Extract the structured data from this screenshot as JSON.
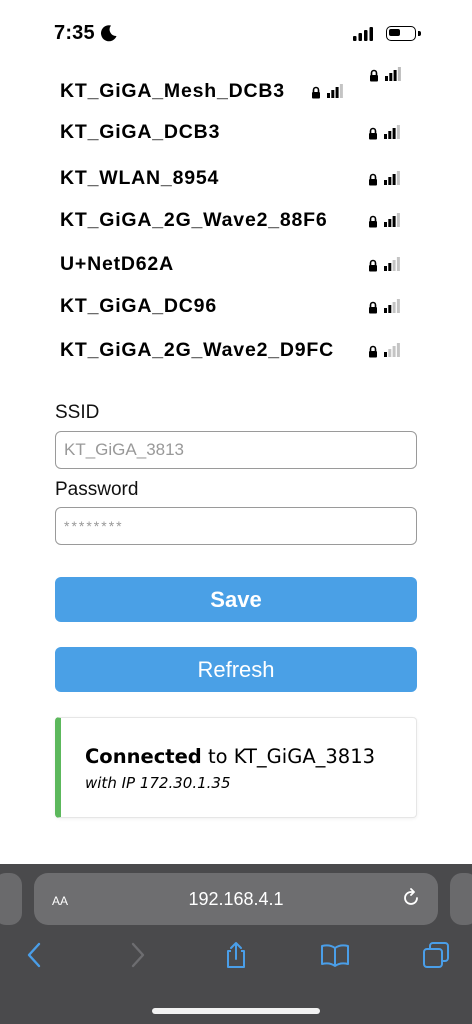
{
  "status_bar": {
    "time": "7:35"
  },
  "networks": [
    {
      "ssid": "KT_GiGA_Mesh_DCB3",
      "signal_bars": 3
    },
    {
      "ssid": "KT_GiGA_DCB3",
      "signal_bars": 3
    },
    {
      "ssid": "KT_WLAN_8954",
      "signal_bars": 3
    },
    {
      "ssid": "KT_GiGA_2G_Wave2_88F6",
      "signal_bars": 3
    },
    {
      "ssid": "U+NetD62A",
      "signal_bars": 2
    },
    {
      "ssid": "KT_GiGA_DC96",
      "signal_bars": 2
    },
    {
      "ssid": "KT_GiGA_2G_Wave2_D9FC",
      "signal_bars": 1
    }
  ],
  "form": {
    "ssid_label": "SSID",
    "ssid_placeholder": "KT_GiGA_3813",
    "password_label": "Password",
    "password_placeholder": "********"
  },
  "buttons": {
    "save": "Save",
    "refresh": "Refresh"
  },
  "status": {
    "connected": "Connected",
    "to_text": " to KT_GiGA_3813",
    "ip_line": "with IP 172.30.1.35"
  },
  "browser": {
    "aa": "AA",
    "url": "192.168.4.1"
  },
  "colors": {
    "accent": "#4aa0e6",
    "success": "#5cb85c",
    "toolbar": "#4a4a4c"
  }
}
